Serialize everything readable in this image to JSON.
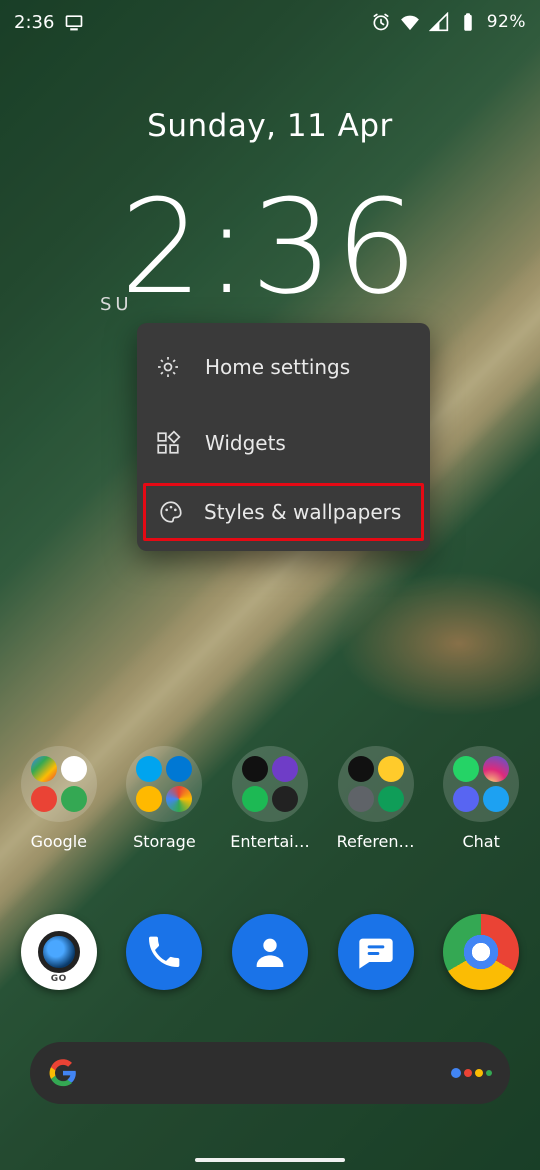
{
  "status_bar": {
    "time": "2:36",
    "battery_percent": "92%"
  },
  "clock_widget": {
    "date": "Sunday, 11 Apr",
    "time": "2:36",
    "weather_prefix": "SU"
  },
  "context_menu": {
    "items": [
      {
        "label": "Home settings"
      },
      {
        "label": "Widgets"
      },
      {
        "label": "Styles & wallpapers"
      }
    ]
  },
  "folder_row": [
    {
      "label": "Google"
    },
    {
      "label": "Storage"
    },
    {
      "label": "Entertai…"
    },
    {
      "label": "Referen…"
    },
    {
      "label": "Chat"
    }
  ],
  "dock": {
    "camera_caption": "GO"
  }
}
